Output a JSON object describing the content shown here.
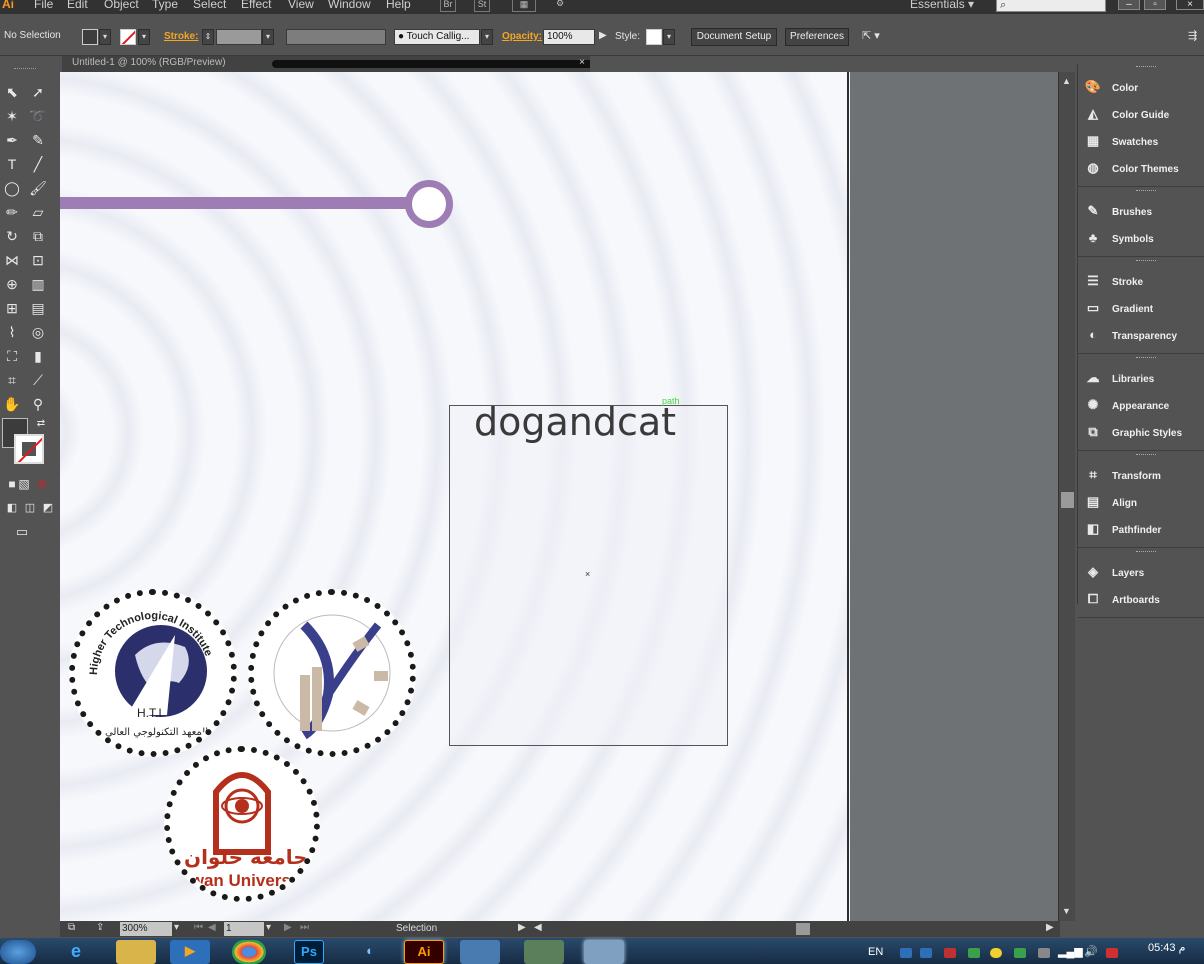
{
  "menubar": {
    "app_logo": "Ai",
    "items": [
      "File",
      "Edit",
      "Object",
      "Type",
      "Select",
      "Effect",
      "View",
      "Window",
      "Help"
    ],
    "icons": [
      "Br",
      "St"
    ],
    "workspace": "Essentials",
    "search_placeholder": "",
    "window_controls": [
      "minimize-icon",
      "maximize-icon",
      "close-icon"
    ]
  },
  "controlbar": {
    "selection_status": "No Selection",
    "stroke_label": "Stroke:",
    "brush_name": "Touch Callig...",
    "opacity_label": "Opacity:",
    "opacity_value": "100%",
    "style_label": "Style:",
    "document_setup": "Document Setup",
    "preferences": "Preferences"
  },
  "document_tab": {
    "title": "Untitled-1 @ 100% (RGB/Preview)",
    "close": "×"
  },
  "artboard": {
    "text": "dogandcat",
    "path_label": "path",
    "center_mark": "×"
  },
  "seals": {
    "hti_arc_text": "Higher Technological Institute",
    "hti_arabic": "المعهد التكنولوجي العالي",
    "hti_initials": "H.T.I",
    "helwan_arabic": "جامعة حلوان",
    "helwan_english": "lwan Univers"
  },
  "right_panel": {
    "groups": [
      [
        {
          "icon": "color-icon",
          "label": "Color"
        },
        {
          "icon": "color-guide-icon",
          "label": "Color Guide"
        },
        {
          "icon": "swatches-icon",
          "label": "Swatches"
        },
        {
          "icon": "color-themes-icon",
          "label": "Color Themes"
        }
      ],
      [
        {
          "icon": "brushes-icon",
          "label": "Brushes"
        },
        {
          "icon": "symbols-icon",
          "label": "Symbols"
        }
      ],
      [
        {
          "icon": "stroke-icon",
          "label": "Stroke"
        },
        {
          "icon": "gradient-icon",
          "label": "Gradient"
        },
        {
          "icon": "transparency-icon",
          "label": "Transparency"
        }
      ],
      [
        {
          "icon": "libraries-icon",
          "label": "Libraries"
        },
        {
          "icon": "appearance-icon",
          "label": "Appearance"
        },
        {
          "icon": "graphic-styles-icon",
          "label": "Graphic Styles"
        }
      ],
      [
        {
          "icon": "transform-icon",
          "label": "Transform"
        },
        {
          "icon": "align-icon",
          "label": "Align"
        },
        {
          "icon": "pathfinder-icon",
          "label": "Pathfinder"
        }
      ],
      [
        {
          "icon": "layers-icon",
          "label": "Layers"
        },
        {
          "icon": "artboards-icon",
          "label": "Artboards"
        }
      ]
    ]
  },
  "statusbar": {
    "zoom": "300%",
    "artboard_number": "1",
    "status": "Selection"
  },
  "taskbar": {
    "apps": [
      "start-orb",
      "internet-explorer",
      "file-explorer",
      "media-player",
      "chrome",
      "photoshop",
      "cinema",
      "illustrator",
      "app-window-1",
      "app-window-2",
      "app-window-3"
    ],
    "ps_label": "Ps",
    "ai_label": "Ai",
    "language": "EN",
    "time": "05:43 م"
  },
  "colors": {
    "slider": "#9d7db4",
    "helwan_red": "#b5301c",
    "hti_navy": "#2b2f6b",
    "accent_orange": "#f5a623"
  }
}
